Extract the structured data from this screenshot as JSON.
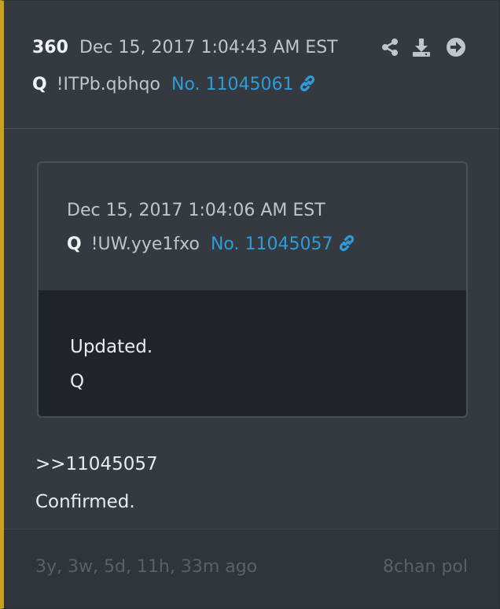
{
  "post": {
    "number": "360",
    "datetime": "Dec 15, 2017 1:04:43 AM EST",
    "author": "Q",
    "tripcode": "!ITPb.qbhqo",
    "post_no": "No. 11045061",
    "actions": [
      "share-icon",
      "download-icon",
      "arrow-circle-right-icon"
    ]
  },
  "quoted": {
    "datetime": "Dec 15, 2017 1:04:06 AM EST",
    "author": "Q",
    "tripcode": "!UW.yye1fxo",
    "post_no": "No. 11045057",
    "lines": [
      "Updated.",
      "Q"
    ]
  },
  "message": {
    "lines": [
      ">>11045057",
      "Confirmed."
    ]
  },
  "footer": {
    "ago": "3y, 3w, 5d, 11h, 33m ago",
    "source": "8chan pol"
  },
  "colors": {
    "accent": "#c9a21a",
    "link": "#2f9bd8"
  }
}
